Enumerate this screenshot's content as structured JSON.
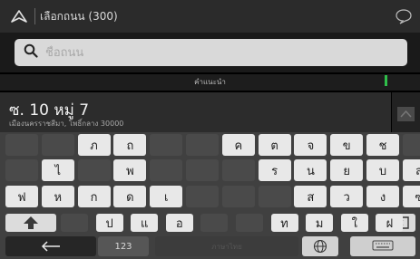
{
  "header": {
    "title": "เลือกถนน (300)"
  },
  "search": {
    "placeholder": "ชื่อถนน"
  },
  "section_label": "คำแนะนำ",
  "result": {
    "title": "ซ. 10 หมู่ 7",
    "subtitle": "เมืองนครราชสีมา, โพธิ์กลาง 30000"
  },
  "keyboard": {
    "row1": [
      {
        "label": "",
        "style": "blank"
      },
      {
        "label": "",
        "style": "blank"
      },
      {
        "label": "ภ",
        "style": "lt"
      },
      {
        "label": "ถ",
        "style": "lt"
      },
      {
        "label": "",
        "style": "blank"
      },
      {
        "label": "",
        "style": "blank"
      },
      {
        "label": "ค",
        "style": "lt"
      },
      {
        "label": "ต",
        "style": "lt"
      },
      {
        "label": "จ",
        "style": "lt"
      },
      {
        "label": "ข",
        "style": "lt"
      },
      {
        "label": "ช",
        "style": "lt"
      },
      {
        "label": "",
        "style": "blank"
      }
    ],
    "row2": [
      {
        "label": "",
        "style": "blank"
      },
      {
        "label": "ไ",
        "style": "lt"
      },
      {
        "label": "",
        "style": "blank"
      },
      {
        "label": "พ",
        "style": "lt"
      },
      {
        "label": "",
        "style": "blank"
      },
      {
        "label": "",
        "style": "blank"
      },
      {
        "label": "",
        "style": "blank"
      },
      {
        "label": "ร",
        "style": "lt"
      },
      {
        "label": "น",
        "style": "lt"
      },
      {
        "label": "ย",
        "style": "lt"
      },
      {
        "label": "บ",
        "style": "lt"
      },
      {
        "label": "ล",
        "style": "lt"
      }
    ],
    "row3": [
      {
        "label": "ฟ",
        "style": "lt"
      },
      {
        "label": "ห",
        "style": "lt"
      },
      {
        "label": "ก",
        "style": "lt"
      },
      {
        "label": "ด",
        "style": "lt"
      },
      {
        "label": "เ",
        "style": "lt"
      },
      {
        "label": "",
        "style": "blank"
      },
      {
        "label": "",
        "style": "blank"
      },
      {
        "label": "",
        "style": "blank"
      },
      {
        "label": "ส",
        "style": "lt"
      },
      {
        "label": "ว",
        "style": "lt"
      },
      {
        "label": "ง",
        "style": "lt"
      },
      {
        "label": "ฃ",
        "style": "lt"
      }
    ],
    "row4": [
      {
        "label": "",
        "style": "blank"
      },
      {
        "label": "ป",
        "style": "lt"
      },
      {
        "label": "แ",
        "style": "lt"
      },
      {
        "label": "อ",
        "style": "lt"
      },
      {
        "label": "",
        "style": "blank"
      },
      {
        "label": "",
        "style": "blank"
      },
      {
        "label": "ท",
        "style": "lt"
      },
      {
        "label": "ม",
        "style": "lt"
      },
      {
        "label": "ใ",
        "style": "lt"
      },
      {
        "label": "ฝ",
        "style": "lt"
      }
    ],
    "numbers_label": "123",
    "space_label": "ภาษาไทย"
  }
}
